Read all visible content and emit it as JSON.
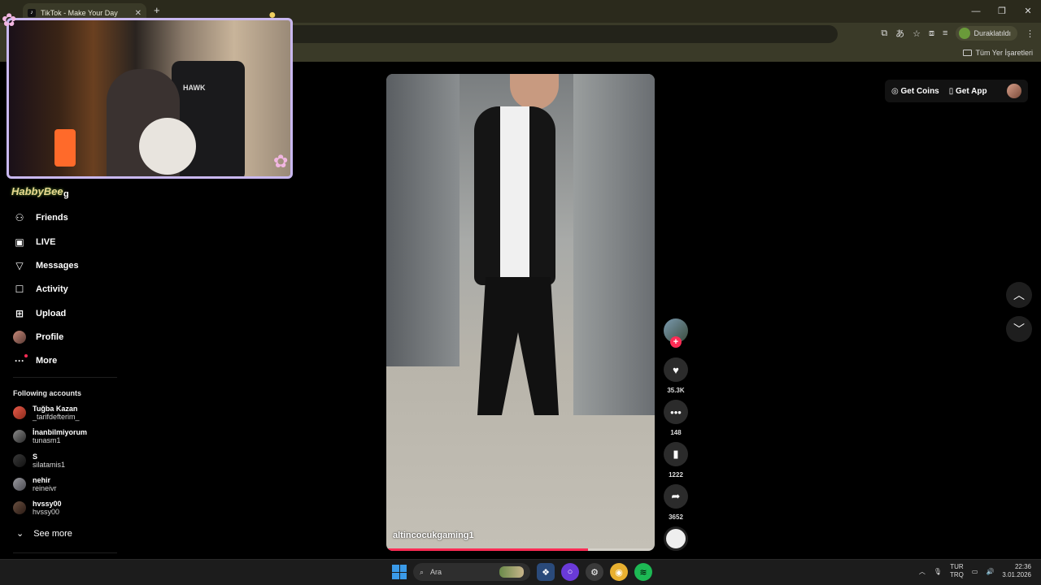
{
  "browser": {
    "tab_title": "TikTok - Make Your Day",
    "tab_close": "✕",
    "new_tab": "+",
    "window_controls": [
      "—",
      "❐",
      "✕"
    ],
    "profile_label": "Duraklatıldı",
    "bookmarks_all": "Tüm Yer İşaretleri"
  },
  "overlay": {
    "brand": "HabbyBee",
    "brand_tail": "g",
    "hawk": "HAWK"
  },
  "sidebar": {
    "items": [
      {
        "label": "Friends",
        "icon": "friends-icon"
      },
      {
        "label": "LIVE",
        "icon": "live-icon"
      },
      {
        "label": "Messages",
        "icon": "messages-icon"
      },
      {
        "label": "Activity",
        "icon": "activity-icon"
      },
      {
        "label": "Upload",
        "icon": "upload-icon"
      },
      {
        "label": "Profile",
        "icon": "profile-avatar"
      },
      {
        "label": "More",
        "icon": "more-icon"
      }
    ],
    "following_header": "Following accounts",
    "accounts": [
      {
        "name": "Tuğba Kazan",
        "username": "_tarifdefterim_"
      },
      {
        "name": "İnanbilmiyorum",
        "username": "tunasm1"
      },
      {
        "name": "S",
        "username": "silatamis1"
      },
      {
        "name": "nehir",
        "username": "reineivr"
      },
      {
        "name": "hvssy00",
        "username": "hvssy00"
      }
    ],
    "see_more": "See more"
  },
  "header": {
    "get_coins": "Get Coins",
    "get_app": "Get App"
  },
  "video": {
    "author": "altincocukgaming1",
    "progress": 0.75
  },
  "actions": {
    "likes": "35.3K",
    "comments": "148",
    "saves": "1222",
    "shares": "3652"
  },
  "taskbar": {
    "search_placeholder": "Ara",
    "lang_top": "TUR",
    "lang_bottom": "TRQ",
    "time": "22:36",
    "date": "3.01.2026"
  },
  "colors": {
    "accent": "#fe2c55",
    "background": "#000000",
    "webcam_border": "#c9b8f0"
  }
}
